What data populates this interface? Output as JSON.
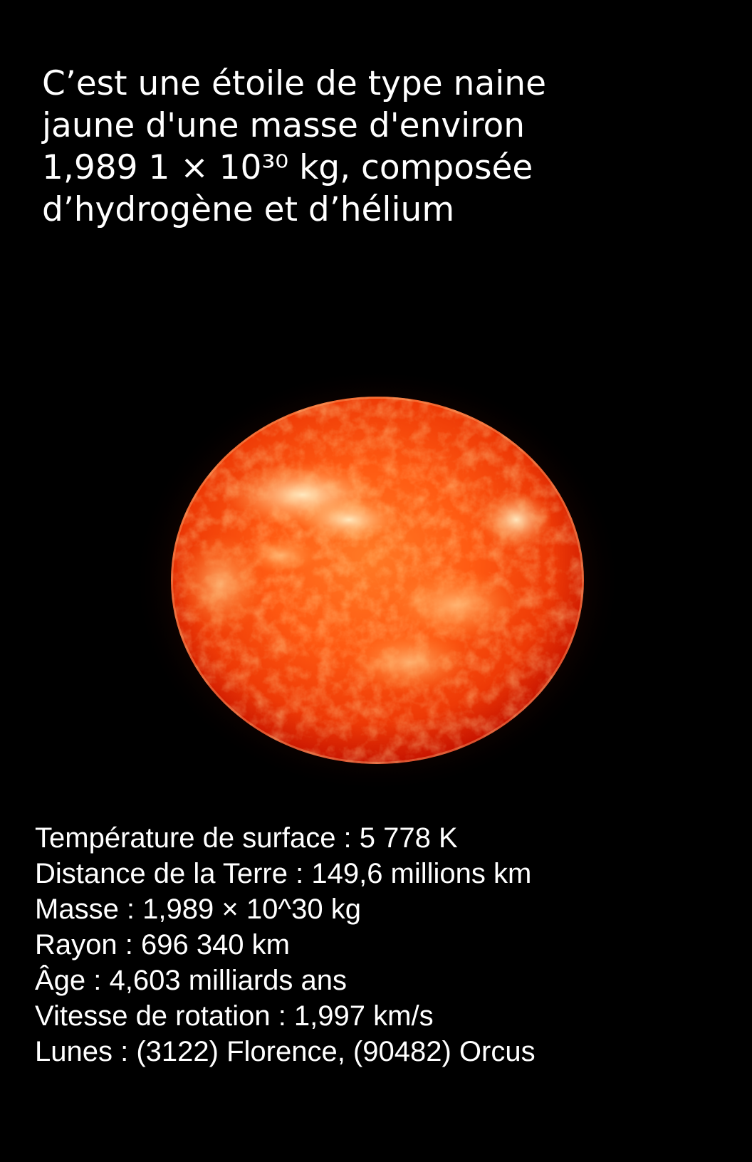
{
  "intro": {
    "lines": [
      "C’est une étoile de type naine",
      "jaune d'une masse d'environ",
      "1,989 1 × 10³⁰ kg, composée",
      "d’hydrogène et d’hélium"
    ]
  },
  "image": {
    "subject": "sun-image",
    "colors": {
      "core": "#ff5a12",
      "highlight": "#fff0c8",
      "edge": "#c81400",
      "glow": "#ff3c00"
    }
  },
  "facts": [
    "Température de surface : 5 778 K",
    "Distance de la Terre : 149,6 millions km",
    "Masse : 1,989 × 10^30 kg",
    "Rayon : 696 340 km",
    "Âge : 4,603 milliards ans",
    "Vitesse de rotation : 1,997 km/s",
    "Lunes : (3122) Florence, (90482) Orcus"
  ]
}
